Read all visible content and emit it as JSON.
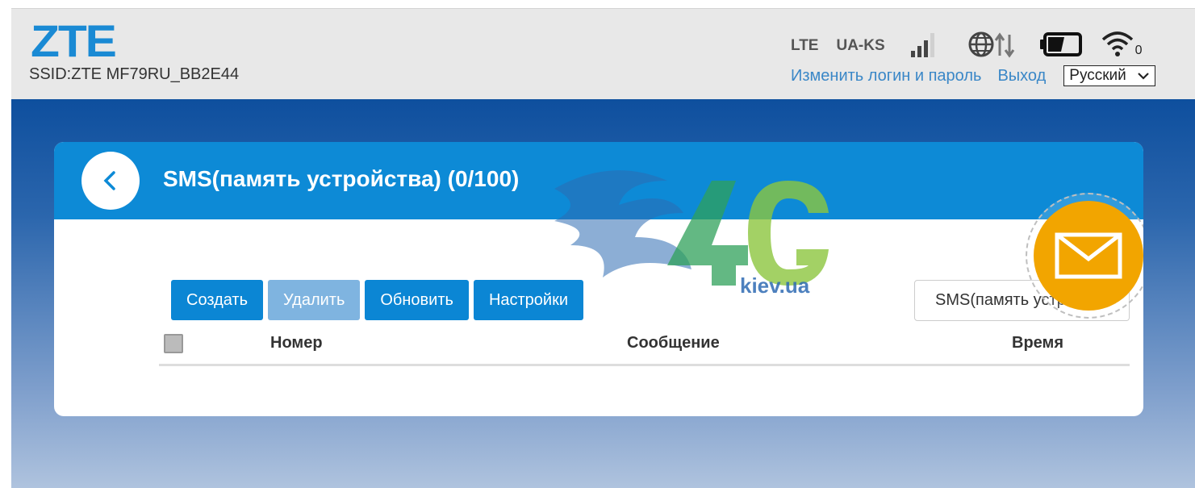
{
  "header": {
    "logo": "ZTE",
    "ssid": "SSID:ZTE MF79RU_BB2E44",
    "network_type": "LTE",
    "operator": "UA-KS",
    "icons": {
      "signal": "signal-bars-icon",
      "internet": "globe-transfer-icon",
      "battery": "battery-icon",
      "wifi": "wifi-icon"
    },
    "wifi_clients": "0",
    "change_login_link": "Изменить логин и пароль",
    "logout_link": "Выход",
    "language": "Русский"
  },
  "page": {
    "title": "SMS(память устройства) (0/100)",
    "watermark_text": "kiev.ua",
    "toolbar": {
      "create": "Создать",
      "delete": "Удалить",
      "refresh": "Обновить",
      "settings": "Настройки"
    },
    "folder_select": "SMS(память устройства)",
    "table": {
      "columns": [
        "Номер",
        "Сообщение",
        "Время"
      ],
      "rows": []
    }
  },
  "colors": {
    "brand": "#1a8ad4",
    "header_bg": "#e8e8e8",
    "card_header": "#0d8ad6",
    "accent_orange": "#f2a500",
    "button": "#0b86d4",
    "button_disabled": "#7fb4e0",
    "link": "#3a87c7"
  }
}
